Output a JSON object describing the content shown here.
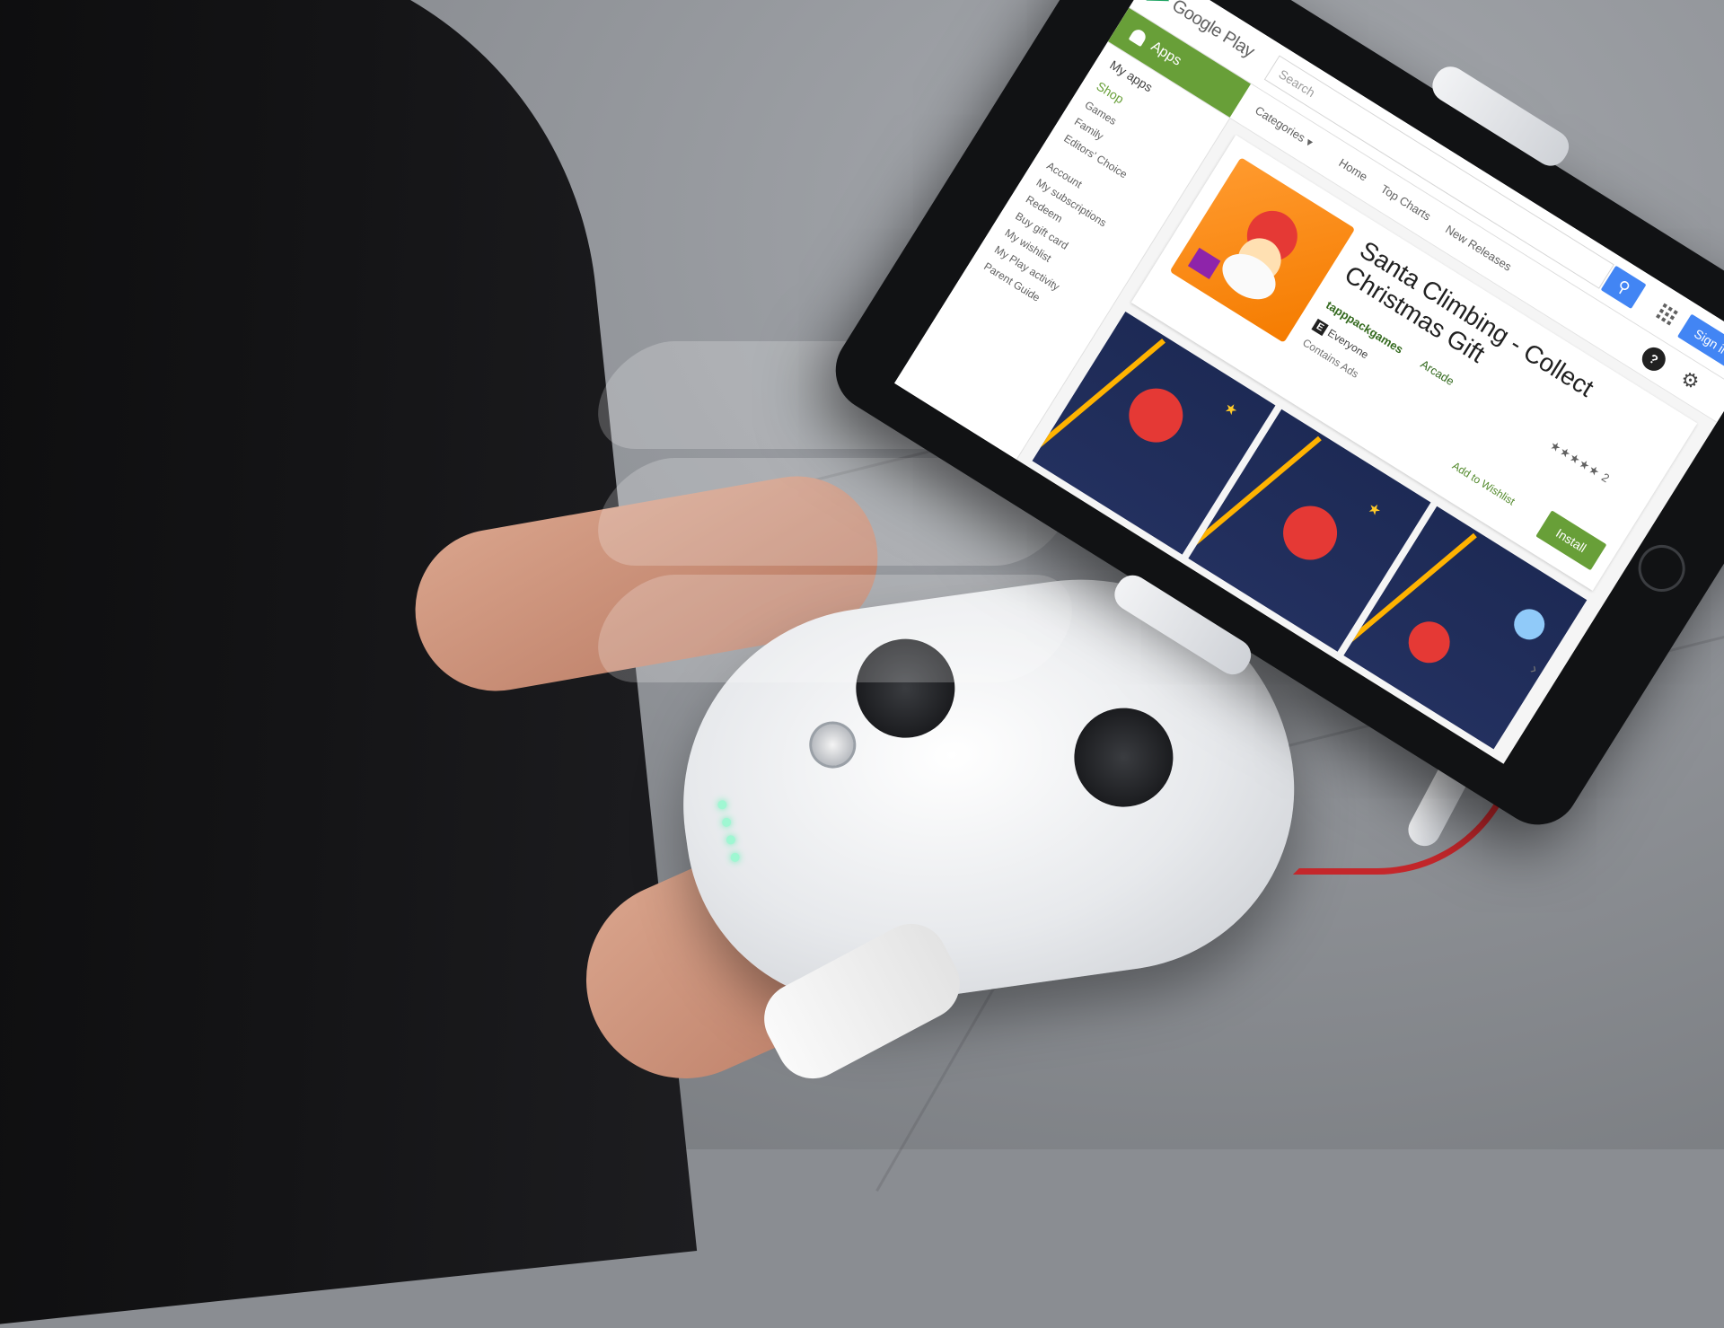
{
  "play": {
    "brand": "Google Play",
    "search_placeholder": "Search",
    "sign_in": "Sign in",
    "apps_tab": "Apps",
    "nav": {
      "categories": "Categories ▾",
      "home": "Home",
      "top_charts": "Top Charts",
      "new_releases": "New Releases"
    }
  },
  "sidebar": {
    "my_apps": "My apps",
    "shop": "Shop",
    "sections": [
      "Games",
      "Family",
      "Editors' Choice"
    ],
    "account_items": [
      "Account",
      "My subscriptions",
      "Redeem",
      "Buy gift card",
      "My wishlist",
      "My Play activity",
      "Parent Guide"
    ]
  },
  "app": {
    "title": "Santa Climbing - Collect Christmas Gift",
    "developer": "tapppackgames",
    "category": "Arcade",
    "content_rating": "Everyone",
    "content_rating_badge": "E",
    "ads_notice": "Contains Ads",
    "stars": "★★★★★ 2",
    "wishlist": "Add to Wishlist",
    "install": "Install"
  },
  "icons": {
    "help": "?",
    "settings": "⚙",
    "search": "⚲",
    "next": "›"
  },
  "colors": {
    "play_green": "#689f38",
    "play_blue": "#4285f4"
  }
}
